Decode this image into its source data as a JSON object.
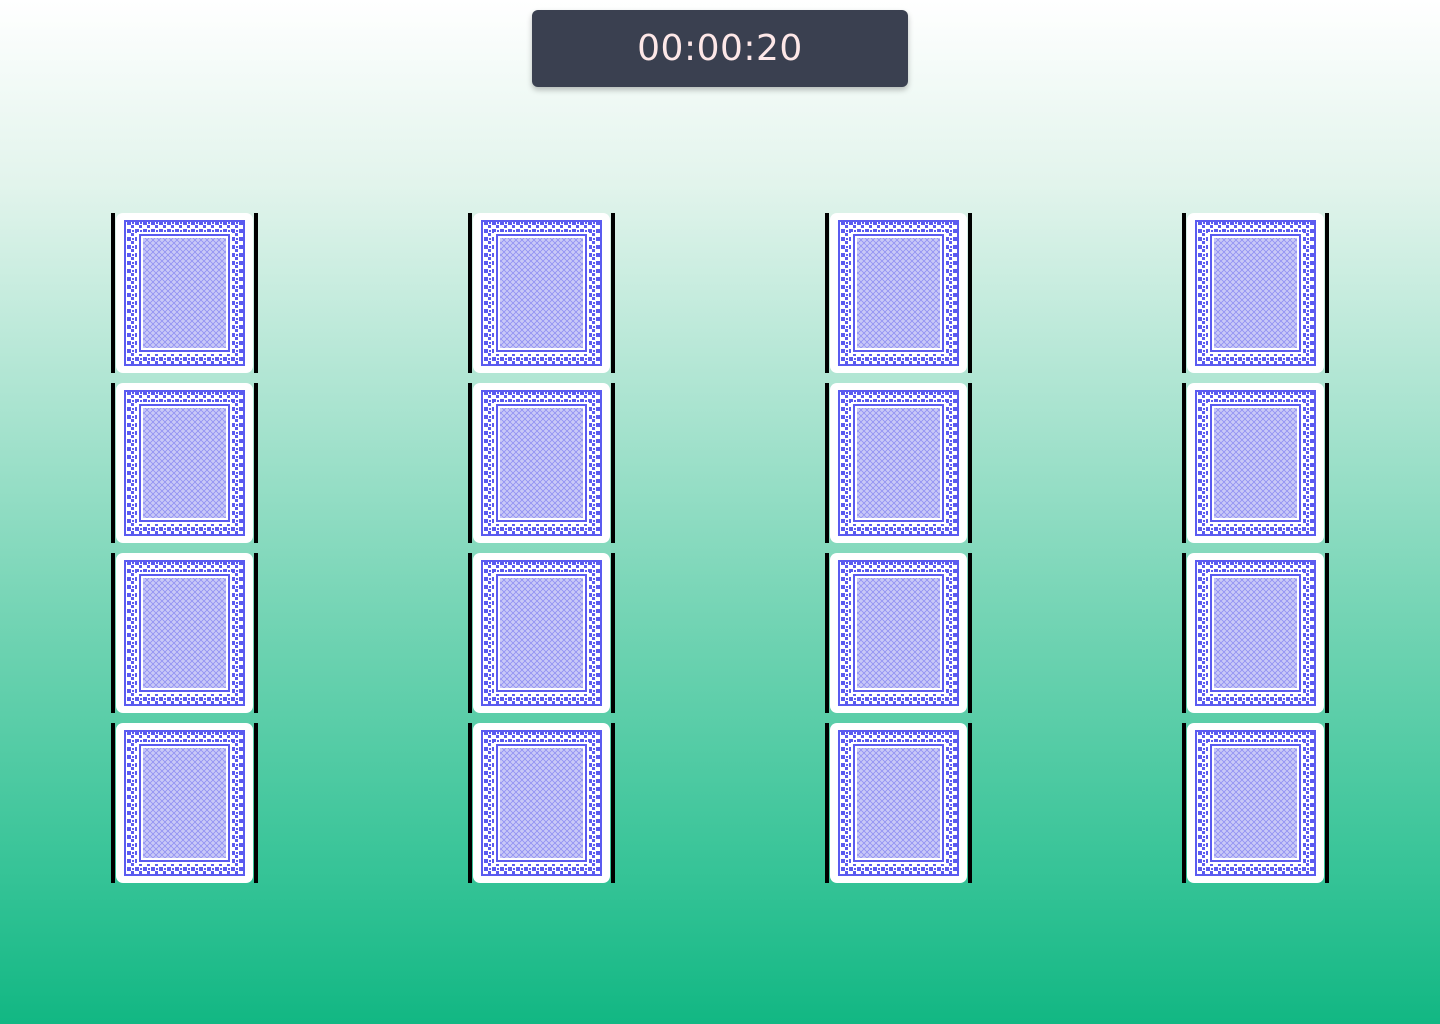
{
  "timer": {
    "value": "00:00:20"
  },
  "board": {
    "rows": 4,
    "columns": 4,
    "cards": [
      {
        "state": "face-down"
      },
      {
        "state": "face-down"
      },
      {
        "state": "face-down"
      },
      {
        "state": "face-down"
      },
      {
        "state": "face-down"
      },
      {
        "state": "face-down"
      },
      {
        "state": "face-down"
      },
      {
        "state": "face-down"
      },
      {
        "state": "face-down"
      },
      {
        "state": "face-down"
      },
      {
        "state": "face-down"
      },
      {
        "state": "face-down"
      },
      {
        "state": "face-down"
      },
      {
        "state": "face-down"
      },
      {
        "state": "face-down"
      },
      {
        "state": "face-down"
      }
    ]
  },
  "colors": {
    "timer_background": "#3a4050",
    "timer_text": "#fde7e7",
    "card_back_pattern": "#5b5bf0",
    "card_back_fill": "#c9c9f7",
    "card_edge": "#000000",
    "card_face": "#ffffff"
  }
}
